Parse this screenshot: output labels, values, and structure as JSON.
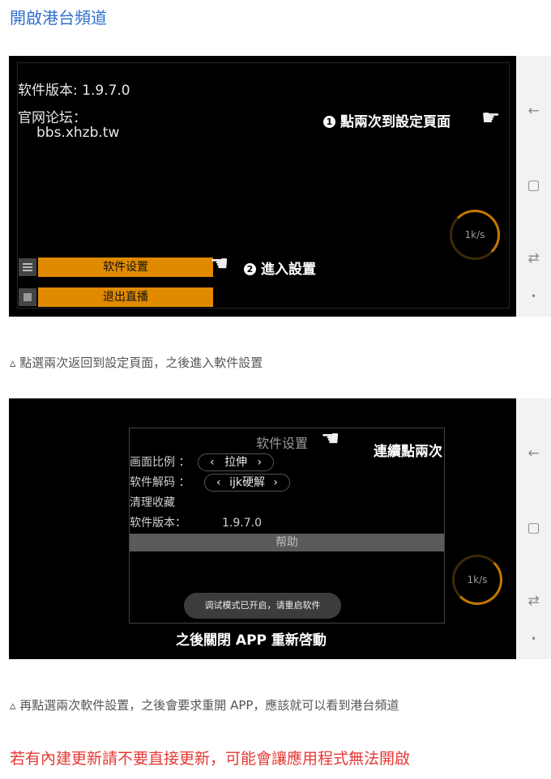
{
  "heading": "開啟港台頻道",
  "screenshot1": {
    "version_text": "软件版本: 1.9.7.0",
    "forum_label": "官网论坛：",
    "forum_url": "bbs.xhzb.tw",
    "annotation1": "點兩次到設定頁面",
    "annotation1_num": "❶",
    "annotation2": "進入設置",
    "annotation2_num": "❷",
    "btn_settings": "软件设置",
    "btn_exit": "退出直播",
    "speed": "1k/s"
  },
  "caption1": "▵ 點選兩次返回到設定頁面，之後進入軟件設置",
  "screenshot2": {
    "dialog_title": "软件设置",
    "annotation": "連續點兩次",
    "rows": [
      {
        "label": "画面比例 ：",
        "value": "拉伸"
      },
      {
        "label": "软件解码 ：",
        "value": "ijk硬解"
      }
    ],
    "clear_label": "清理收藏",
    "version_label": "软件版本：",
    "version_value": "1.9.7.0",
    "help": "帮助",
    "toast": "调试模式已开启，请重启软件",
    "bottom_annotation": "之後關閉 APP 重新啓動",
    "speed": "1k/s",
    "left_arrow": "‹",
    "right_arrow": "›"
  },
  "caption2": "▵ 再點選兩次軟件設置，之後會要求重開 APP，應該就可以看到港台頻道",
  "warning": "若有內建更新請不要直接更新，可能會讓應用程式無法開啟",
  "nav_icons": [
    "back-arrow-icon",
    "recents-square-icon",
    "switch-icon",
    "dot-icon"
  ],
  "colors": {
    "heading": "#2f6fd0",
    "warning": "#e53935",
    "button": "#e08a00"
  }
}
